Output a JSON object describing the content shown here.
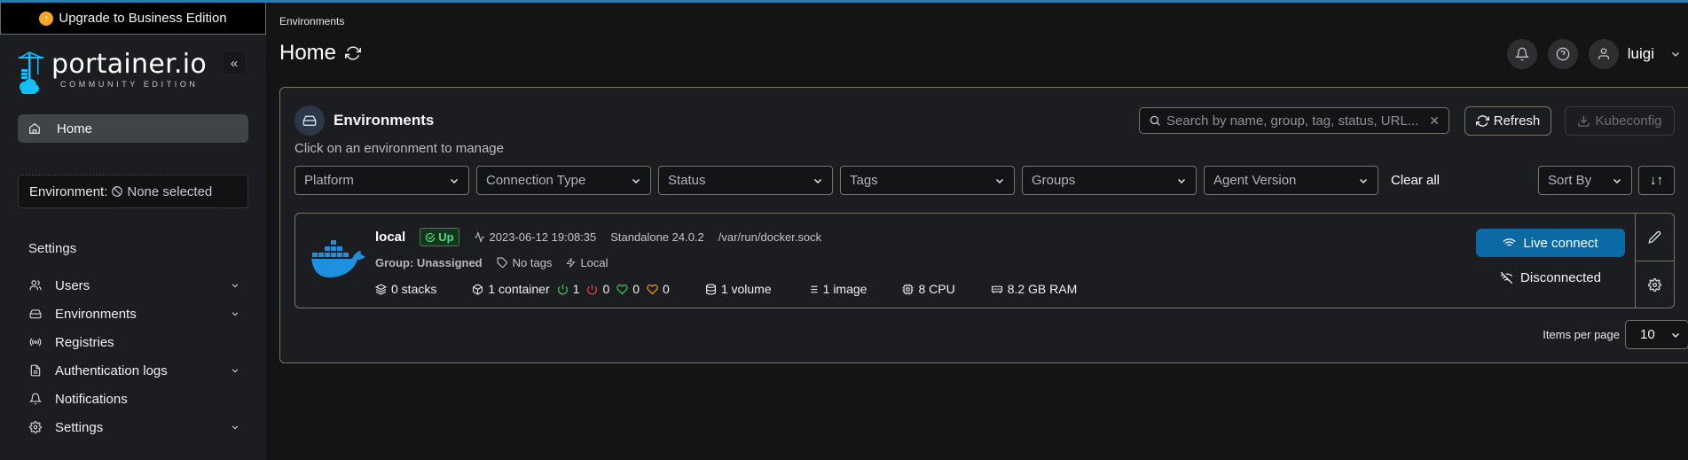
{
  "colors": {
    "accent": "#2a7bb2",
    "primary_button": "#0b6aa3",
    "status_up": "#4ade80",
    "running": "#34d058",
    "stopped": "#ef4444",
    "healthy": "#34d058",
    "unhealthy": "#f59e0b",
    "upgrade_icon": "#f6a623",
    "logo_blue": "#13bef9"
  },
  "sidebar": {
    "upgrade_label": "Upgrade to Business Edition",
    "logo": {
      "name": "portainer.io",
      "edition": "COMMUNITY EDITION"
    },
    "collapse_label": "«",
    "home_label": "Home",
    "environment": {
      "label": "Environment:",
      "value": "None selected"
    },
    "settings_title": "Settings",
    "items": [
      {
        "label": "Users",
        "icon": "users-icon",
        "expandable": true
      },
      {
        "label": "Environments",
        "icon": "hard-drive-icon",
        "expandable": true
      },
      {
        "label": "Registries",
        "icon": "radio-icon",
        "expandable": false
      },
      {
        "label": "Authentication logs",
        "icon": "file-text-icon",
        "expandable": true
      },
      {
        "label": "Notifications",
        "icon": "bell-icon",
        "expandable": false
      },
      {
        "label": "Settings",
        "icon": "gear-icon",
        "expandable": true
      }
    ]
  },
  "header": {
    "breadcrumb": "Environments",
    "title": "Home",
    "user": "luigi"
  },
  "environments_panel": {
    "title": "Environments",
    "subtitle": "Click on an environment to manage",
    "search_placeholder": "Search by name, group, tag, status, URL...",
    "search_value": "",
    "refresh_label": "Refresh",
    "kubeconfig_label": "Kubeconfig",
    "filters": [
      "Platform",
      "Connection Type",
      "Status",
      "Tags",
      "Groups",
      "Agent Version"
    ],
    "clear_all_label": "Clear all",
    "sort_by_label": "Sort By",
    "sort_direction_label": "↓↑",
    "items_per_page_label": "Items per page",
    "items_per_page_value": "10",
    "environments": [
      {
        "name": "local",
        "status": "Up",
        "timestamp": "2023-06-12 19:08:35",
        "type": "Standalone 24.0.2",
        "url": "/var/run/docker.sock",
        "group": "Group: Unassigned",
        "tags": "No tags",
        "connection": "Local",
        "stacks": "0 stacks",
        "containers": "1 container",
        "running": "1",
        "stopped": "0",
        "healthy": "0",
        "unhealthy": "0",
        "volumes": "1 volume",
        "images": "1 image",
        "cpu": "8 CPU",
        "ram": "8.2 GB RAM",
        "live_connect_label": "Live connect",
        "connection_state": "Disconnected"
      }
    ]
  }
}
